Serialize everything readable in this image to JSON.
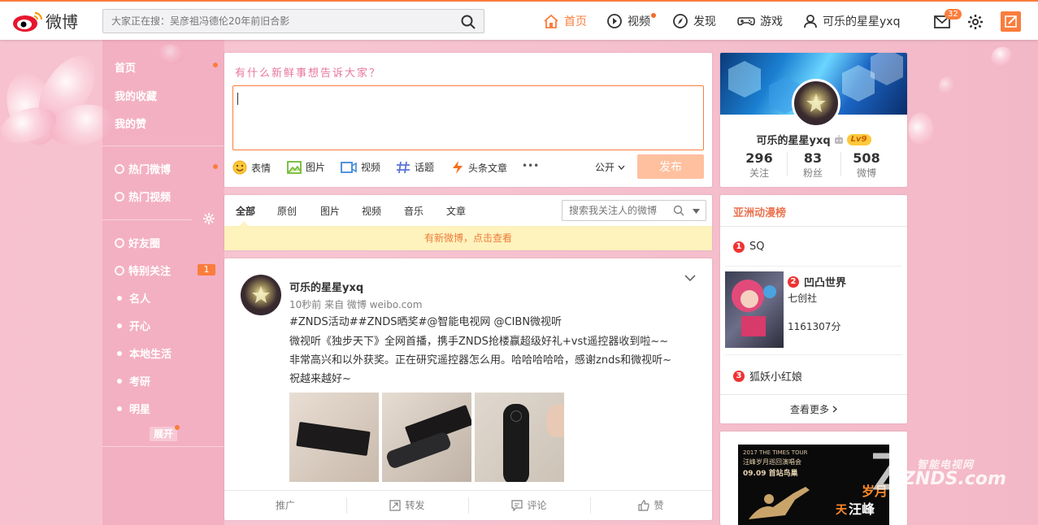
{
  "header": {
    "logo_text": "微博",
    "search_placeholder": "大家正在搜：吴彦祖冯德伦20年前旧合影",
    "nav": {
      "home": "首页",
      "video": "视频",
      "discover": "发现",
      "game": "游戏",
      "user": "可乐的星星yxq"
    },
    "message_count": "32",
    "accent_color": "#fa7d3c"
  },
  "sidebar": {
    "items": [
      {
        "label": "首页"
      },
      {
        "label": "我的收藏"
      },
      {
        "label": "我的赞"
      },
      {
        "label": "热门微博"
      },
      {
        "label": "热门视频"
      },
      {
        "label": "好友圈"
      },
      {
        "label": "特别关注",
        "badge": "1"
      },
      {
        "label": "名人"
      },
      {
        "label": "开心"
      },
      {
        "label": "本地生活"
      },
      {
        "label": "考研"
      },
      {
        "label": "明星"
      }
    ],
    "expand_label": "展开"
  },
  "publisher": {
    "title": "有什么新鲜事想告诉大家？",
    "tools": {
      "emoji": "表情",
      "image": "图片",
      "video": "视频",
      "topic": "话题",
      "article": "头条文章",
      "more": "•••"
    },
    "visibility": "公开",
    "send_label": "发布"
  },
  "tabs": {
    "items": [
      "全部",
      "原创",
      "图片",
      "视频",
      "音乐",
      "文章"
    ],
    "search_placeholder": "搜索我关注人的微博",
    "notice": "有新微博，点击查看"
  },
  "post": {
    "author": "可乐的星星yxq",
    "meta": "10秒前 来自 微博 weibo.com",
    "tags": "#ZNDS活动##ZNDS晒奖#@智能电视网  @CIBN微视听",
    "line1": "微视听《独步天下》全网首播，携手ZNDS抢楼赢超级好礼+vst遥控器收到啦~~",
    "line2": "非常高兴和以外获奖。正在研究遥控器怎么用。哈哈哈哈哈，感谢znds和微视听~",
    "line3": "祝越来越好~",
    "actions": {
      "promote": "推广",
      "repost": "转发",
      "comment": "评论",
      "like": "赞"
    }
  },
  "profile": {
    "name": "可乐的星星yxq",
    "level": "Lv9",
    "stats": [
      {
        "num": "296",
        "label": "关注"
      },
      {
        "num": "83",
        "label": "粉丝"
      },
      {
        "num": "508",
        "label": "微博"
      }
    ]
  },
  "ranking": {
    "title": "亚洲动漫榜",
    "items": [
      {
        "rank": "1",
        "name": "SQ"
      },
      {
        "rank": "2",
        "name": "凹凸世界",
        "author": "七创社",
        "score": "1161307分"
      },
      {
        "rank": "3",
        "name": "狐妖小红娘"
      }
    ],
    "more": "查看更多"
  },
  "ad": {
    "small_top": "2017 THE TIMES TOUR",
    "line1": "汪峰岁月巡回演唱会",
    "line2": "09.09 首站鸟巢",
    "big1": "天",
    "big2": "汪峰",
    "big3": "岁月"
  },
  "watermark": {
    "line1": "智能电视网",
    "line2": "ZNDS.com"
  }
}
